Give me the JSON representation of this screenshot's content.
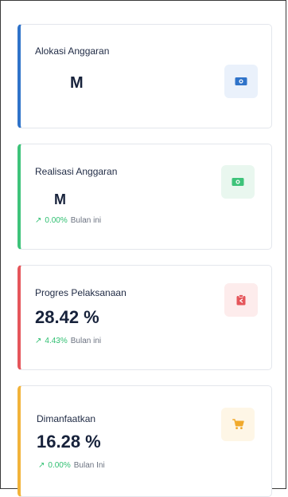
{
  "cards": [
    {
      "title": "Alokasi Anggaran",
      "value": "M",
      "icon": "money-bill-icon",
      "accent": "#2f73c9",
      "icon_color": "#2f73c9",
      "icon_bg": "#eaf1fb"
    },
    {
      "title": "Realisasi Anggaran",
      "value": "M",
      "trend": {
        "pct": "0.00%",
        "period": "Bulan ini"
      },
      "icon": "money-bill-icon",
      "accent": "#3ec37a",
      "icon_color": "#3ec37a",
      "icon_bg": "#e9f7ef"
    },
    {
      "title": "Progres Pelaksanaan",
      "value": "28.42 %",
      "trend": {
        "pct": "4.43%",
        "period": "Bulan ini"
      },
      "icon": "clipboard-icon",
      "accent": "#e5565b",
      "icon_color": "#e5565b",
      "icon_bg": "#fdecec"
    },
    {
      "title": "Dimanfaatkan",
      "value": "16.28 %",
      "trend": {
        "pct": "0.00%",
        "period": "Bulan Ini"
      },
      "icon": "cart-icon",
      "accent": "#f2b33a",
      "icon_color": "#f0a92b",
      "icon_bg": "#fef6e6"
    }
  ]
}
